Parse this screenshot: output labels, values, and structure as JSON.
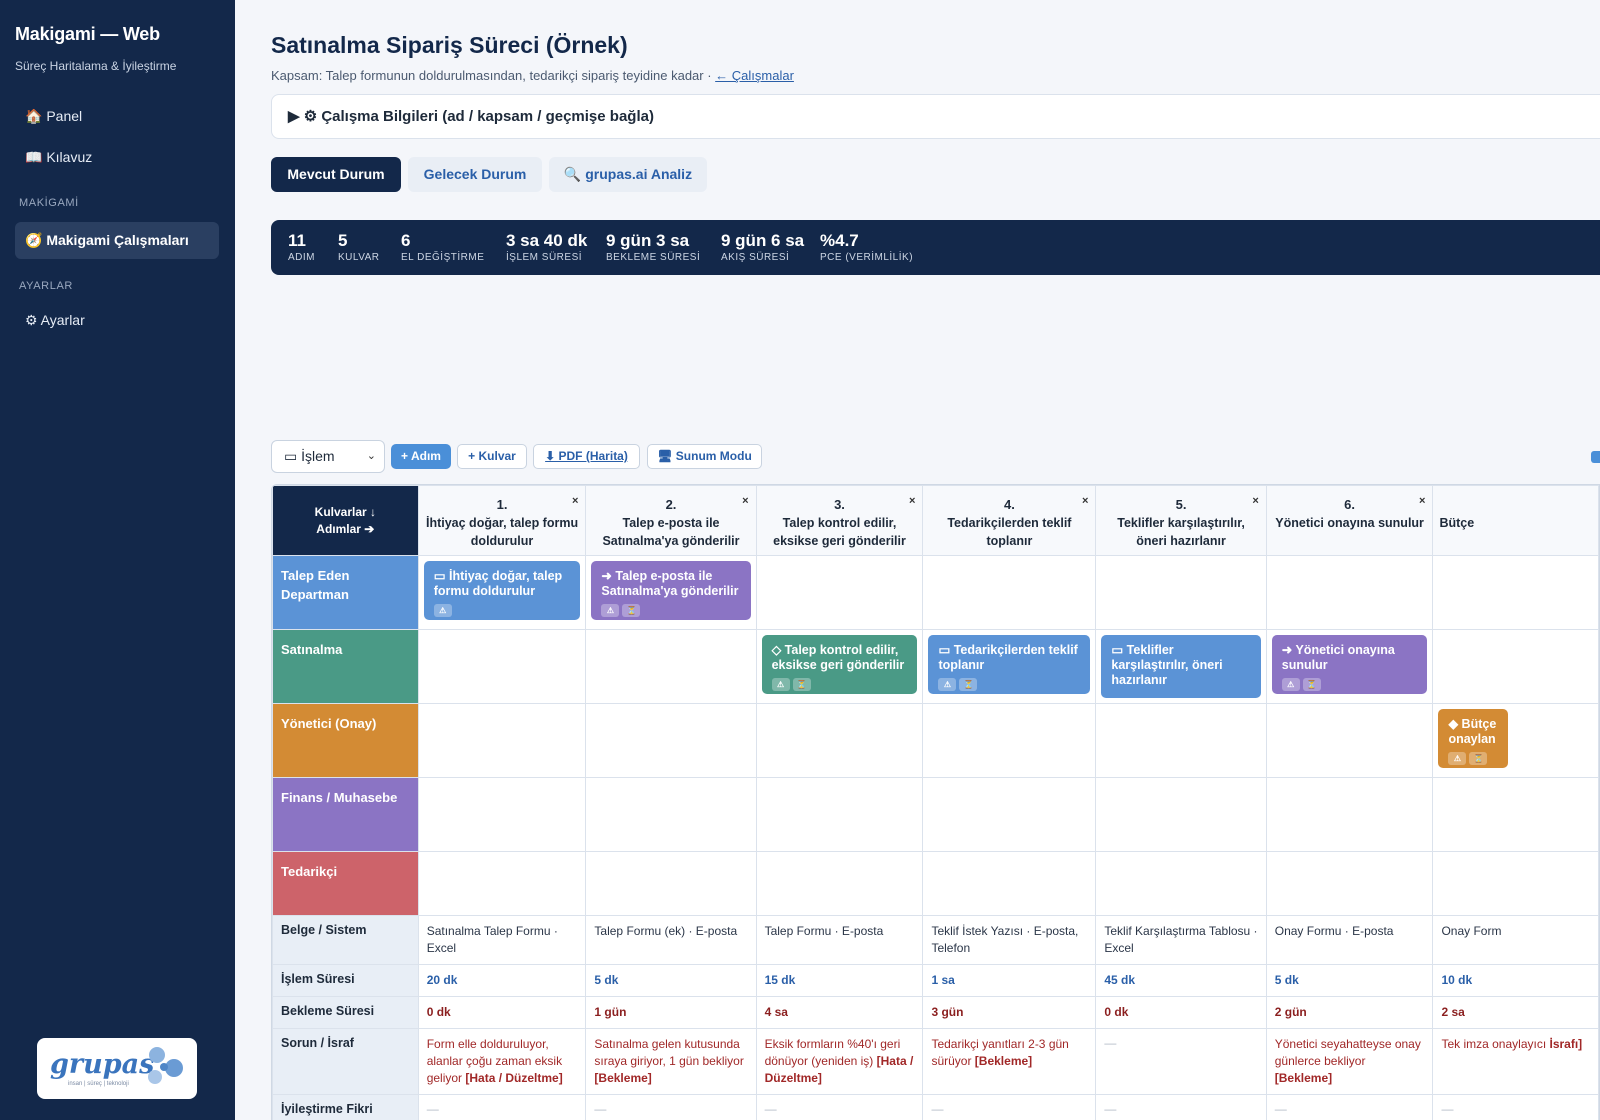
{
  "sidebar": {
    "brand": "Makigami — Web",
    "tagline": "Süreç Haritalama & İyileştirme",
    "items": [
      {
        "label": "🏠 Panel"
      },
      {
        "label": "📖 Kılavuz"
      },
      {
        "label": "🧭 Makigami Çalışmaları"
      },
      {
        "label": "⚙ Ayarlar"
      }
    ],
    "sections": [
      "MAKİGAMİ",
      "AYARLAR"
    ],
    "logo": {
      "text": "grupas",
      "sub": "insan | süreç | teknoloji"
    }
  },
  "page": {
    "title": "Satınalma Sipariş Süreci (Örnek)",
    "scope": "Kapsam: Talep formunun doldurulmasından, tedarikçi sipariş teyidine kadar",
    "scope_sep": " · ",
    "back_link": "← Çalışmalar",
    "infobox": "▶ ⚙ Çalışma Bilgileri (ad / kapsam / geçmişe bağla)"
  },
  "tabs": [
    {
      "label": "Mevcut Durum",
      "active": true
    },
    {
      "label": "Gelecek Durum",
      "active": false
    },
    {
      "label": "🔍 grupas.ai Analiz",
      "active": false
    }
  ],
  "metrics": [
    {
      "value": "11",
      "label": "ADIM"
    },
    {
      "value": "5",
      "label": "KULVAR"
    },
    {
      "value": "6",
      "label": "EL DEĞİŞTİRME"
    },
    {
      "value": "3 sa 40 dk",
      "label": "İŞLEM SÜRESİ"
    },
    {
      "value": "9 gün 3 sa",
      "label": "BEKLEME SÜRESİ"
    },
    {
      "value": "9 gün 6 sa",
      "label": "AKIŞ SÜRESİ"
    },
    {
      "value": "%4.7",
      "label": "PCE (VERİMLİLİK)"
    }
  ],
  "toolbar": {
    "select_value": "▭ İşlem",
    "add_step": "+ Adım",
    "add_lane": "+ Kulvar",
    "pdf": "⬇ PDF (Harita)",
    "present": "🖥 Sunum Modu"
  },
  "grid": {
    "corner": [
      "Kulvarlar ↓",
      "Adımlar ➔"
    ],
    "steps": [
      {
        "num": "1.",
        "title": "İhtiyaç doğar, talep formu doldurulur"
      },
      {
        "num": "2.",
        "title": "Talep e-posta ile Satınalma'ya gönderilir"
      },
      {
        "num": "3.",
        "title": "Talep kontrol edilir, eksikse geri gönderilir"
      },
      {
        "num": "4.",
        "title": "Tedarikçilerden teklif toplanır"
      },
      {
        "num": "5.",
        "title": "Teklifler karşılaştırılır, öneri hazırlanır"
      },
      {
        "num": "6.",
        "title": "Yönetici onayına sunulur"
      },
      {
        "num": "",
        "title": "Bütçe"
      }
    ],
    "lanes": [
      {
        "name": "Talep Eden Departman",
        "color": "#5b93d6"
      },
      {
        "name": "Satınalma",
        "color": "#4a9a86"
      },
      {
        "name": "Yönetici (Onay)",
        "color": "#d38b34"
      },
      {
        "name": "Finans / Muhasebe",
        "color": "#8b74c4"
      },
      {
        "name": "Tedarikçi",
        "color": "#cd636a"
      }
    ],
    "cards": [
      {
        "step": 0,
        "lane": 0,
        "text": "▭ İhtiyaç doğar, talep formu doldurulur",
        "color": "#5b93d6",
        "icons": [
          "⚠"
        ]
      },
      {
        "step": 1,
        "lane": 0,
        "text": "➜ Talep e-posta ile Satınalma'ya gönderilir",
        "color": "#8b74c4",
        "icons": [
          "⚠",
          "⏳"
        ]
      },
      {
        "step": 2,
        "lane": 1,
        "text": "◇ Talep kontrol edilir, eksikse geri gönderilir",
        "color": "#4a9a86",
        "icons": [
          "⚠",
          "⏳"
        ]
      },
      {
        "step": 3,
        "lane": 1,
        "text": "▭ Tedarikçilerden teklif toplanır",
        "color": "#5b93d6",
        "icons": [
          "⚠",
          "⏳"
        ]
      },
      {
        "step": 4,
        "lane": 1,
        "text": "▭ Teklifler karşılaştırılır, öneri hazırlanır",
        "color": "#5b93d6",
        "icons": []
      },
      {
        "step": 5,
        "lane": 1,
        "text": "➜ Yönetici onayına sunulur",
        "color": "#8b74c4",
        "icons": [
          "⚠",
          "⏳"
        ]
      },
      {
        "step": 6,
        "lane": 2,
        "text": "◆ Bütçe onaylan",
        "color": "#d38b34",
        "icons": [
          "⚠",
          "⏳"
        ]
      }
    ],
    "rows": {
      "doc": {
        "label": "Belge / Sistem",
        "values": [
          "Satınalma Talep Formu · Excel",
          "Talep Formu (ek) · E-posta",
          "Talep Formu · E-posta",
          "Teklif İstek Yazısı · E-posta, Telefon",
          "Teklif Karşılaştırma Tablosu · Excel",
          "Onay Formu · E-posta",
          "Onay Form"
        ]
      },
      "proc": {
        "label": "İşlem Süresi",
        "values": [
          "20 dk",
          "5 dk",
          "15 dk",
          "1 sa",
          "45 dk",
          "5 dk",
          "10 dk"
        ]
      },
      "wait": {
        "label": "Bekleme Süresi",
        "values": [
          "0 dk",
          "1 gün",
          "4 sa",
          "3 gün",
          "0 dk",
          "2 gün",
          "2 sa"
        ]
      },
      "problem": {
        "label": "Sorun / İsraf",
        "values": [
          {
            "text": "Form elle dolduruluyor, alanlar çoğu zaman eksik geliyor ",
            "tag": "[Hata / Düzeltme]"
          },
          {
            "text": "Satınalma gelen kutusunda sıraya giriyor, 1 gün bekliyor ",
            "tag": "[Bekleme]"
          },
          {
            "text": "Eksik formların %40'ı geri dönüyor (yeniden iş) ",
            "tag": "[Hata / Düzeltme]"
          },
          {
            "text": "Tedarikçi yanıtları 2-3 gün sürüyor ",
            "tag": "[Bekleme]"
          },
          {
            "text": "—",
            "tag": ""
          },
          {
            "text": "Yönetici seyahatteyse onay günlerce bekliyor ",
            "tag": "[Bekleme]"
          },
          {
            "text": "Tek imza onaylayıcı ",
            "tag": "İsrafı]"
          }
        ]
      },
      "improve": {
        "label": "İyileştirme Fikri",
        "values": [
          "—",
          "—",
          "—",
          "—",
          "—",
          "—",
          "—"
        ]
      }
    }
  }
}
